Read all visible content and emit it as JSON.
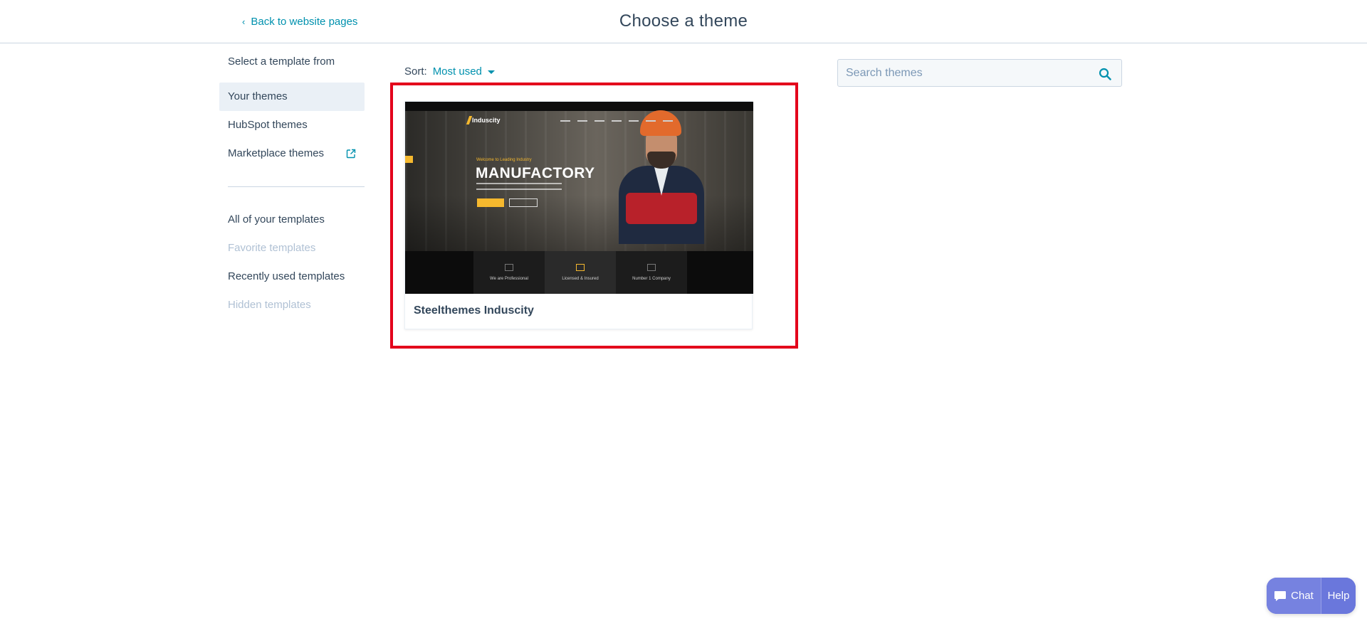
{
  "header": {
    "back_label": "Back to website pages",
    "title": "Choose a theme"
  },
  "sidebar": {
    "heading": "Select a template from",
    "theme_items": [
      {
        "label": "Your themes",
        "active": true
      },
      {
        "label": "HubSpot themes"
      },
      {
        "label": "Marketplace themes",
        "icon": "external-link-icon"
      }
    ],
    "template_items": [
      {
        "label": "All of your templates"
      },
      {
        "label": "Favorite templates",
        "disabled": true
      },
      {
        "label": "Recently used templates"
      },
      {
        "label": "Hidden templates",
        "disabled": true
      }
    ]
  },
  "sort": {
    "label": "Sort:",
    "value": "Most used"
  },
  "themes": [
    {
      "name": "Steelthemes Induscity",
      "preview": {
        "brand": "Induscity",
        "kicker": "Welcome to Leading Industry",
        "hero_title": "MANUFACTORY",
        "features": [
          "We are Professional",
          "Licensed & Insured",
          "Number 1 Company"
        ]
      }
    }
  ],
  "search": {
    "placeholder": "Search themes"
  },
  "chat_widget": {
    "chat_label": "Chat",
    "help_label": "Help"
  },
  "colors": {
    "accent": "#0091ae",
    "text": "#33475b",
    "highlight": "#e3001b",
    "chat": "#7682e0"
  }
}
